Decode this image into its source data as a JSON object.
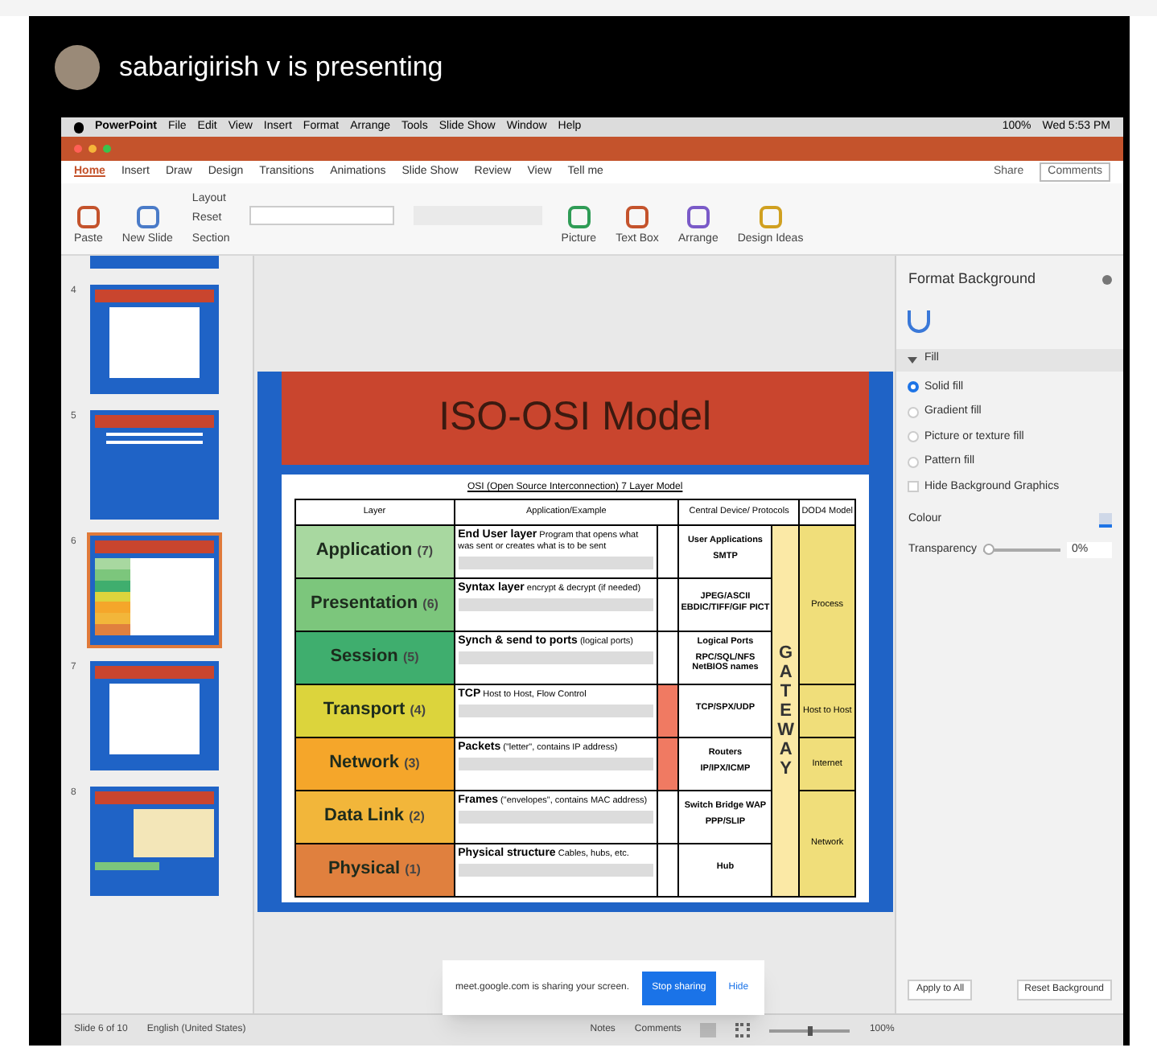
{
  "call": {
    "presenter": "sabarigirish v is presenting"
  },
  "menu_bar": {
    "items": [
      "PowerPoint",
      "File",
      "Edit",
      "View",
      "Insert",
      "Format",
      "Arrange",
      "Tools",
      "Slide Show",
      "Window",
      "Help"
    ],
    "battery": "100%",
    "clock": "Wed 5:53 PM"
  },
  "ribbon": {
    "tabs": [
      {
        "label": "Home",
        "selected": true
      },
      {
        "label": "Insert",
        "selected": false
      },
      {
        "label": "Draw",
        "selected": false
      },
      {
        "label": "Design",
        "selected": false
      },
      {
        "label": "Transitions",
        "selected": false
      },
      {
        "label": "Animations",
        "selected": false
      },
      {
        "label": "Slide Show",
        "selected": false
      },
      {
        "label": "Review",
        "selected": false
      },
      {
        "label": "View",
        "selected": false
      }
    ],
    "tell_me": "Tell me",
    "share": "Share",
    "comments": "Comments",
    "tools": [
      {
        "label": "Paste"
      },
      {
        "label": "New Slide"
      },
      {
        "label": "Picture"
      },
      {
        "label": "Text Box"
      },
      {
        "label": "Arrange"
      },
      {
        "label": "Design Ideas"
      }
    ],
    "small_tools": [
      "Layout",
      "Reset",
      "Section"
    ]
  },
  "thumbnails": [
    {
      "selected": false,
      "kind": "partial"
    },
    {
      "number": "4",
      "selected": false,
      "kind": "diagram"
    },
    {
      "number": "5",
      "selected": false,
      "kind": "bullets"
    },
    {
      "number": "6",
      "selected": true,
      "kind": "table"
    },
    {
      "number": "7",
      "selected": false,
      "kind": "stack"
    },
    {
      "number": "8",
      "selected": false,
      "kind": "chart"
    }
  ],
  "slide": {
    "title": "ISO-OSI Model",
    "caption": "OSI (Open Source Interconnection) 7 Layer Model",
    "columns": [
      "Layer",
      "Application/Example",
      "Central Device/ Protocols",
      "DOD4 Model"
    ],
    "gateway": "GATEWAY",
    "layers": [
      {
        "name": "Application",
        "number": "(7)",
        "color": "#a8d8a0",
        "example": "End User layer",
        "detail": "Program that opens what was sent or creates what is to be sent",
        "devices": [
          "User Applications",
          "SMTP"
        ],
        "packet_filtering": false,
        "dod4": "Process"
      },
      {
        "name": "Presentation",
        "number": "(6)",
        "color": "#7cc67c",
        "example": "Syntax layer",
        "detail": "encrypt & decrypt (if needed)",
        "devices": [
          "JPEG/ASCII EBDIC/TIFF/GIF PICT"
        ],
        "packet_filtering": false
      },
      {
        "name": "Session",
        "number": "(5)",
        "color": "#3fae6e",
        "example": "Synch & send to ports",
        "detail": "(logical ports)",
        "devices": [
          "Logical Ports",
          "RPC/SQL/NFS NetBIOS names"
        ],
        "packet_filtering": false
      },
      {
        "name": "Transport",
        "number": "(4)",
        "color": "#dcd43c",
        "example": "TCP",
        "detail": "Host to Host, Flow Control",
        "devices": [
          "TCP/SPX/UDP"
        ],
        "packet_filtering": true,
        "dod4": "Host to Host"
      },
      {
        "name": "Network",
        "number": "(3)",
        "color": "#f5a62a",
        "example": "Packets",
        "detail": "(\"letter\", contains IP address)",
        "devices": [
          "Routers",
          "IP/IPX/ICMP"
        ],
        "packet_filtering": true,
        "dod4": "Internet"
      },
      {
        "name": "Data Link",
        "number": "(2)",
        "color": "#f2b63a",
        "example": "Frames",
        "detail": "(\"envelopes\", contains MAC address)",
        "devices": [
          "Switch Bridge WAP",
          "PPP/SLIP"
        ],
        "packet_filtering": false,
        "dod4": "Network"
      },
      {
        "name": "Physical",
        "number": "(1)",
        "color": "#e0803e",
        "example": "Physical structure",
        "detail": "Cables, hubs, etc.",
        "devices": [
          "Hub"
        ],
        "packet_filtering": false
      }
    ]
  },
  "format_panel": {
    "title": "Format Background",
    "section": "Fill",
    "expanded": true,
    "fill_options": [
      {
        "label": "Solid fill",
        "selected": true
      },
      {
        "label": "Gradient fill",
        "selected": false
      },
      {
        "label": "Picture or texture fill",
        "selected": false
      },
      {
        "label": "Pattern fill",
        "selected": false
      }
    ],
    "hide_graphics": {
      "label": "Hide Background Graphics",
      "checked": false
    },
    "colour_label": "Colour",
    "transparency": {
      "label": "Transparency",
      "level": 0,
      "reading": "0%"
    },
    "buttons": [
      "Apply to All",
      "Reset Background"
    ]
  },
  "status_bar": {
    "slide": "Slide 6 of 10",
    "language": "English (United States)",
    "notes": "Notes",
    "comments": "Comments",
    "zoom_slider": {
      "level": 0.5
    },
    "zoom": "100%"
  },
  "share_notice": {
    "message": "meet.google.com is sharing your screen.",
    "stop": "Stop sharing",
    "hide": "Hide"
  }
}
